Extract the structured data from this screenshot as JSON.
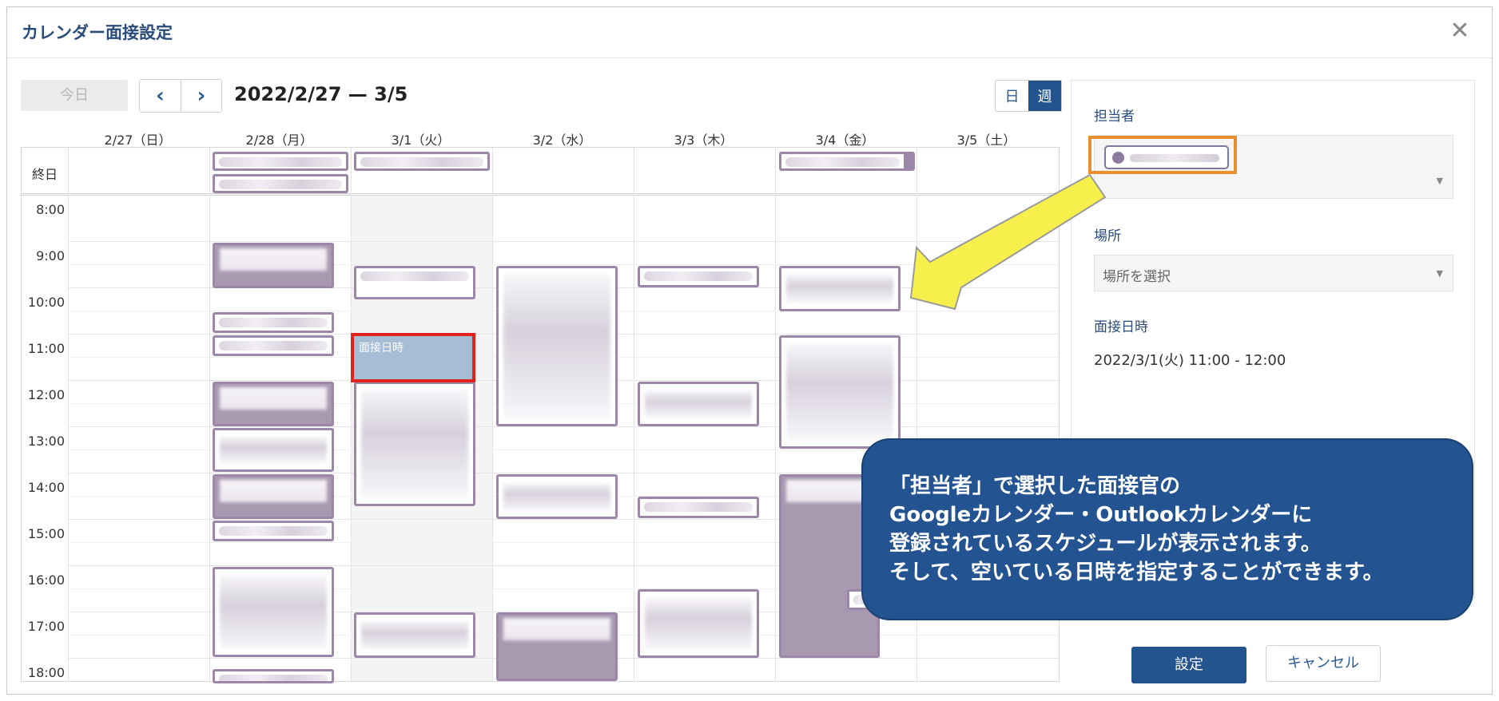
{
  "dialog": {
    "title": "カレンダー面接設定",
    "close_glyph": "✕"
  },
  "toolbar": {
    "today_label": "今日",
    "prev_glyph": "‹",
    "next_glyph": "›",
    "date_range": "2022/2/27 — 3/5",
    "view_day": "日",
    "view_week": "週",
    "active_view": "週"
  },
  "calendar": {
    "allday_label": "終日",
    "days": [
      "2/27（日）",
      "2/28（月）",
      "3/1（火）",
      "3/2（水）",
      "3/3（木）",
      "3/4（金）",
      "3/5（土）"
    ],
    "times": [
      "8:00",
      "9:00",
      "10:00",
      "11:00",
      "12:00",
      "13:00",
      "14:00",
      "15:00",
      "16:00",
      "17:00",
      "18:00"
    ],
    "selected_event_label": "面接日時"
  },
  "side": {
    "assignee_label": "担当者",
    "location_label": "場所",
    "location_placeholder": "場所を選択",
    "datetime_label": "面接日時",
    "datetime_value": "2022/3/1(火) 11:00 - 12:00"
  },
  "callout": {
    "lines": [
      "「担当者」で選択した面接官の",
      "Googleカレンダー・Outlookカレンダーに",
      "登録されているスケジュールが表示されます。",
      "そして、空いている日時を指定することができます。"
    ]
  },
  "footer": {
    "set_label": "設定",
    "cancel_label": "キャンセル"
  },
  "colors": {
    "brand": "#24548e",
    "event_border": "#9c87a8",
    "event_fill": "#a898b0",
    "selected_event": "#a6bdd6",
    "highlight_red": "#e0241b",
    "highlight_orange": "#e8902e",
    "arrow_yellow": "#f7f04c"
  }
}
